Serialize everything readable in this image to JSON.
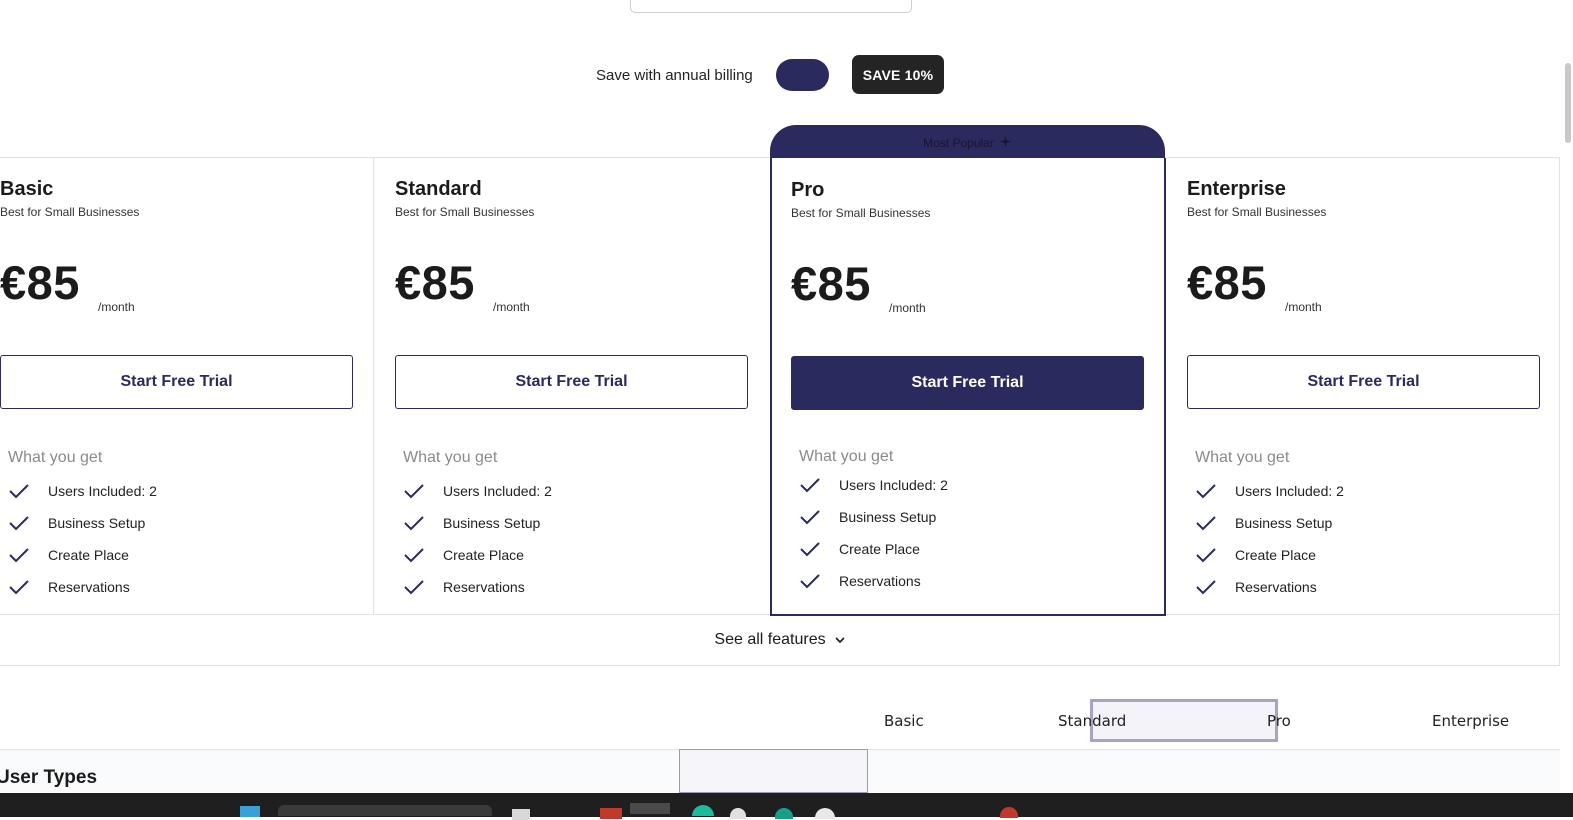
{
  "billing": {
    "label": "Save with annual billing",
    "toggle_on": true,
    "badge": "SAVE 10%"
  },
  "popular_label": "Most Popular",
  "plans": [
    {
      "name": "Basic",
      "subtitle": "Best for Small Businesses",
      "price": "€85",
      "period": "/month",
      "cta": "Start Free Trial",
      "features_title": "What you get",
      "features": [
        "Users Included: 2",
        "Business Setup",
        "Create Place",
        "Reservations"
      ]
    },
    {
      "name": "Standard",
      "subtitle": "Best for Small Businesses",
      "price": "€85",
      "period": "/month",
      "cta": "Start Free Trial",
      "features_title": "What you get",
      "features": [
        "Users Included: 2",
        "Business Setup",
        "Create Place",
        "Reservations"
      ]
    },
    {
      "name": "Pro",
      "subtitle": "Best for Small Businesses",
      "price": "€85",
      "period": "/month",
      "cta": "Start Free Trial",
      "features_title": "What you get",
      "features": [
        "Users Included: 2",
        "Business Setup",
        "Create Place",
        "Reservations"
      ]
    },
    {
      "name": "Enterprise",
      "subtitle": "Best for Small Businesses",
      "price": "€85",
      "period": "/month",
      "cta": "Start Free Trial",
      "features_title": "What you get",
      "features": [
        "Users Included: 2",
        "Business Setup",
        "Create Place",
        "Reservations"
      ]
    }
  ],
  "see_all": "See all features",
  "compare_columns": [
    "Basic",
    "Standard",
    "Pro",
    "Enterprise"
  ],
  "section_title": "User Types",
  "colors": {
    "accent": "#2b2a5f",
    "badge_bg": "#242424"
  }
}
